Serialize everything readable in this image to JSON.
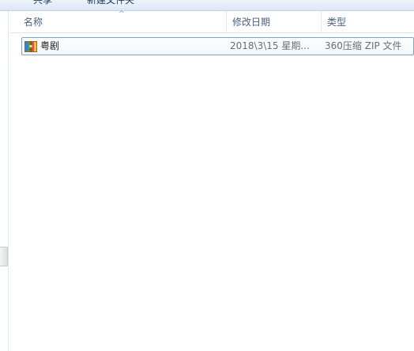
{
  "toolbar": {
    "share_label": "共享",
    "new_folder_label": "新建文件夹"
  },
  "columns": {
    "name": "名称",
    "date": "修改日期",
    "type": "类型",
    "sort_indicator": "^"
  },
  "files": [
    {
      "name": "粤剧",
      "modified": "2018\\3\\15 星期...",
      "type": "360压缩 ZIP 文件",
      "icon": "zip-archive-icon"
    }
  ],
  "colors": {
    "selection_border": "#7da2ce",
    "header_text": "#4c607a",
    "toolbar_bg": "#dce7f5"
  }
}
